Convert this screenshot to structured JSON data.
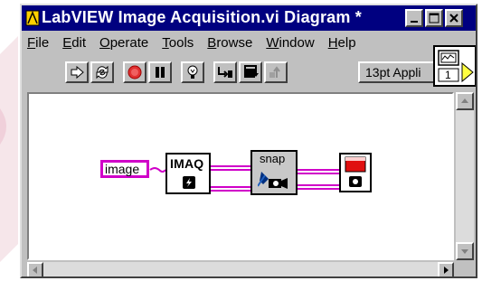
{
  "window": {
    "title": "LabVIEW Image Acquisition.vi Diagram *",
    "title_color": "#000080"
  },
  "menu": {
    "items": [
      "File",
      "Edit",
      "Operate",
      "Tools",
      "Browse",
      "Window",
      "Help"
    ],
    "underlined_letters": [
      "F",
      "E",
      "O",
      "T",
      "B",
      "W",
      "H"
    ]
  },
  "toolbar": {
    "buttons": [
      "run-arrow-icon",
      "run-continuous-icon",
      "abort-icon",
      "pause-icon",
      "highlight-execution-bulb-icon",
      "step-into-icon",
      "step-over-icon",
      "step-out-icon"
    ],
    "font_ring": "13pt Appli"
  },
  "connector_icon": {
    "label": "1"
  },
  "diagram": {
    "image_constant": "image",
    "imaq_node_label": "IMAQ",
    "snap_node_label": "snap",
    "wire_color": "#d000c8"
  },
  "colors": {
    "window_bg": "#c0c0c0",
    "canvas_bg": "#ffffff",
    "image_wire": "#d000c8"
  }
}
